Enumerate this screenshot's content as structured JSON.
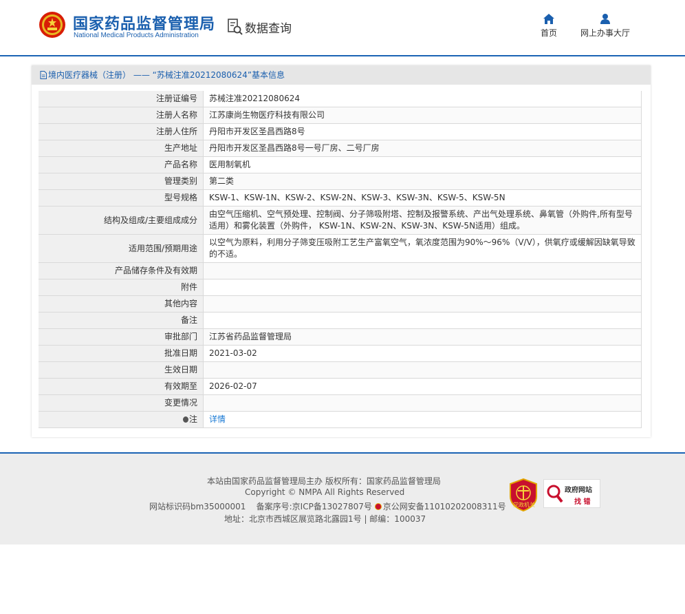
{
  "header": {
    "logo_cn": "国家药品监督管理局",
    "logo_en": "National Medical Products Administration",
    "data_query": "数据查询",
    "nav": [
      {
        "label": "首页",
        "icon": "home-icon"
      },
      {
        "label": "网上办事大厅",
        "icon": "user-icon"
      }
    ]
  },
  "panel": {
    "title": "境内医疗器械（注册） —— “苏械注准20212080624”基本信息",
    "rows": [
      {
        "label": "注册证编号",
        "value": "苏械注准20212080624"
      },
      {
        "label": "注册人名称",
        "value": "江苏康尚生物医疗科技有限公司"
      },
      {
        "label": "注册人住所",
        "value": "丹阳市开发区圣昌西路8号"
      },
      {
        "label": "生产地址",
        "value": "丹阳市开发区圣昌西路8号一号厂房、二号厂房"
      },
      {
        "label": "产品名称",
        "value": "医用制氧机"
      },
      {
        "label": "管理类别",
        "value": "第二类"
      },
      {
        "label": "型号规格",
        "value": "KSW-1、KSW-1N、KSW-2、KSW-2N、KSW-3、KSW-3N、KSW-5、KSW-5N"
      },
      {
        "label": "结构及组成/主要组成成分",
        "value": "由空气压缩机、空气预处理、控制阀、分子筛吸附塔、控制及报警系统、产出气处理系统、鼻氧管（外购件,所有型号适用）和雾化装置（外购件， KSW-1N、KSW-2N、KSW-3N、KSW-5N适用）组成。"
      },
      {
        "label": "适用范围/预期用途",
        "value": "以空气为原料，利用分子筛变压吸附工艺生产富氧空气，氧浓度范围为90%～96%（V/V），供氧疗或缓解因缺氧导致的不适。"
      },
      {
        "label": "产品储存条件及有效期",
        "value": ""
      },
      {
        "label": "附件",
        "value": ""
      },
      {
        "label": "其他内容",
        "value": ""
      },
      {
        "label": "备注",
        "value": ""
      },
      {
        "label": "审批部门",
        "value": "江苏省药品监督管理局"
      },
      {
        "label": "批准日期",
        "value": "2021-03-02"
      },
      {
        "label": "生效日期",
        "value": ""
      },
      {
        "label": "有效期至",
        "value": "2026-02-07"
      },
      {
        "label": "变更情况",
        "value": ""
      }
    ],
    "note_label": "注",
    "note_link": "详情"
  },
  "footer": {
    "line1": "本站由国家药品监督管理局主办 版权所有：国家药品监督管理局",
    "line2": "Copyright © NMPA All Rights Reserved",
    "line3_a": "网站标识码bm35000001    备案序号:京ICP备13027807号 ",
    "line3_b": "京公网安备11010202008311号",
    "line4": "地址：北京市西城区展览路北露园1号 | 邮编：100037",
    "badge1_text": "党政机关",
    "badge2_top": "政府网站",
    "badge2_bottom": "找 错"
  },
  "colors": {
    "brand": "#1a5fae",
    "link": "#1a7ad4",
    "badge_red": "#c8102e"
  }
}
